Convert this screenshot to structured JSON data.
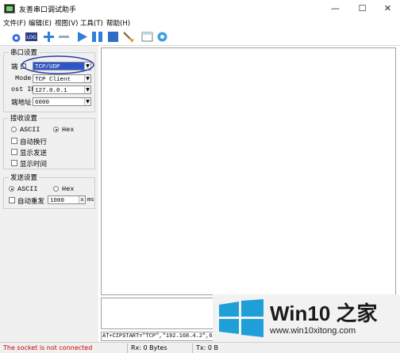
{
  "window": {
    "title": "友善串口调试助手",
    "controls": {
      "minimize": "—",
      "maximize": "☐",
      "close": "✕"
    }
  },
  "menu": [
    "文件(F)",
    "编辑(E)",
    "视图(V)",
    "工具(T)",
    "帮助(H)"
  ],
  "toolbar": {
    "icons": [
      "connect-icon",
      "log-icon",
      "add-icon",
      "remove-icon",
      "play-icon",
      "pause-icon",
      "stop-icon",
      "clear-icon",
      "new-window-icon",
      "settings-icon"
    ]
  },
  "serial_settings": {
    "title": "串口设置",
    "port_label": "端 口",
    "port_value": "TCP/UDP",
    "mode_label": "Mode",
    "mode_value": "TCP Client",
    "host_label": "ost IP",
    "host_value": "127.0.0.1",
    "port_num_label": "端地址",
    "port_num_value": "6000"
  },
  "receive_settings": {
    "title": "接收设置",
    "ascii_label": "ASCII",
    "hex_label": "Hex",
    "selected": "Hex",
    "auto_wrap_label": "自动换行",
    "show_send_label": "显示发送",
    "show_time_label": "显示时间"
  },
  "send_settings": {
    "title": "发送设置",
    "ascii_label": "ASCII",
    "hex_label": "Hex",
    "selected": "ASCII",
    "auto_resend_label": "自动重发",
    "interval_value": "1000",
    "interval_unit": "ms"
  },
  "command_line": "AT+CIPSTART=\"TCP\",\"192.168.4.2\",6(",
  "status": {
    "message": "The socket is not connected",
    "message_color": "#cc0000",
    "rx": "Rx: 0 Bytes",
    "tx": "Tx: 0 B"
  },
  "watermark": {
    "brand": "Win10 之家",
    "url": "www.win10xitong.com",
    "logo_color": "#1e9fd8"
  }
}
